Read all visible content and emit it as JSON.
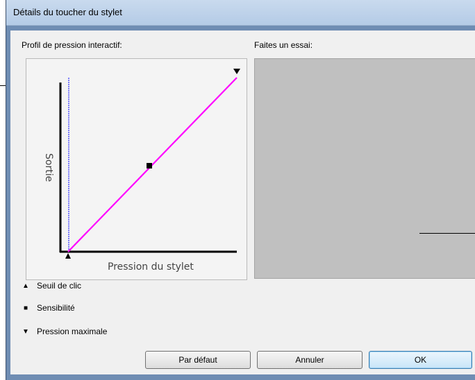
{
  "window": {
    "title": "Détails du toucher du stylet"
  },
  "graph": {
    "heading": "Profil de pression interactif:",
    "y_axis_label": "Sortie",
    "x_axis_label": "Pression du stylet",
    "curve_color": "#ff00ff",
    "threshold_line_color": "#0000ff"
  },
  "trial": {
    "heading": "Faites un essai:"
  },
  "legend": [
    {
      "symbol": "▲",
      "label": "Seuil de clic"
    },
    {
      "symbol": "■",
      "label": "Sensibilité"
    },
    {
      "symbol": "▼",
      "label": "Pression maximale"
    }
  ],
  "buttons": {
    "default_label": "Par défaut",
    "cancel_label": "Annuler",
    "ok_label": "OK"
  }
}
